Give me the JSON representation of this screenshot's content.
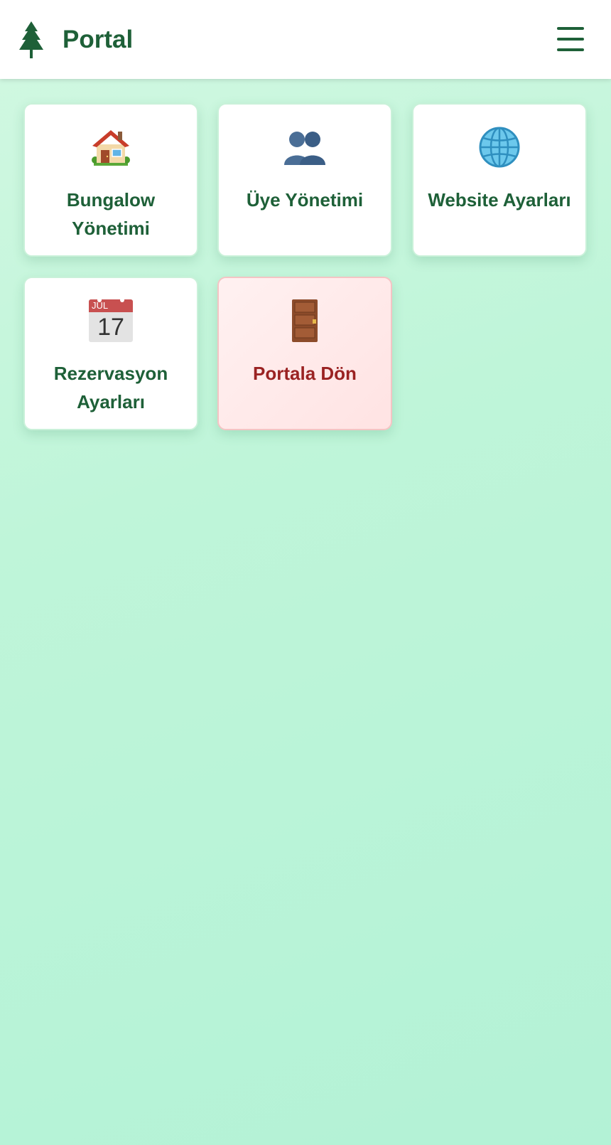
{
  "header": {
    "logo_icon": "pine-tree-icon",
    "title": "Portal",
    "menu_icon": "hamburger-menu-icon"
  },
  "cards": [
    {
      "icon": "house-icon",
      "label": "Bungalow Yönetimi"
    },
    {
      "icon": "people-icon",
      "label": "Üye Yönetimi"
    },
    {
      "icon": "globe-icon",
      "label": "Website Ayarları"
    },
    {
      "icon": "calendar-icon",
      "label": "Rezervasyon Ayarları",
      "calendar_month": "JUL",
      "calendar_day": "17"
    },
    {
      "icon": "door-icon",
      "label": "Portala Dön"
    }
  ],
  "colors": {
    "brand": "#1e6038",
    "exit_text": "#9a2222",
    "exit_bg": "#ffe3e3",
    "background": "#bff5d9"
  }
}
